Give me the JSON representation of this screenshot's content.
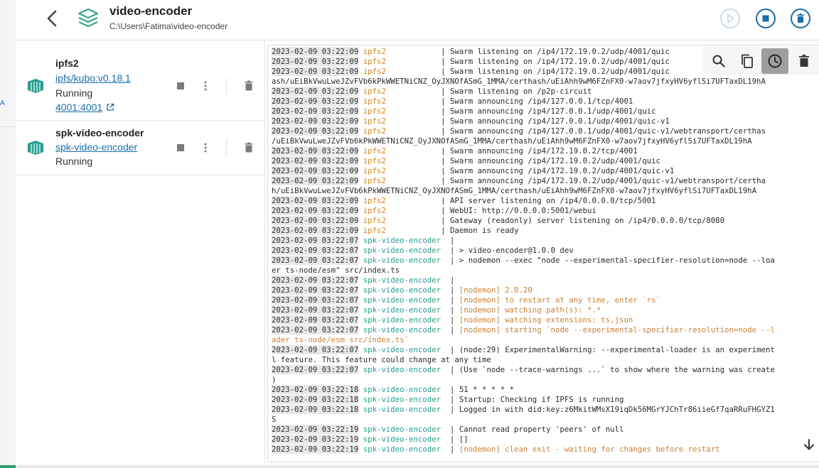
{
  "header": {
    "title": "video-encoder",
    "path": "C:\\Users\\Fatima\\video-encoder"
  },
  "leftrail": {
    "letter": "A"
  },
  "containers": [
    {
      "name": "ipfs2",
      "image": "ipfs/kubo:v0.18.1",
      "status": "Running",
      "port": "4001:4001"
    },
    {
      "name": "spk-video-encoder",
      "image": "spk-video-encoder",
      "status": "Running"
    }
  ],
  "colors": {
    "accent": "#1a6fa8",
    "container_icon": "#2a9d8f",
    "ipfs_service": "#d9841a",
    "spk_service": "#2a9d8f",
    "nodemon": "#c8833a"
  },
  "icons": {
    "header": [
      "back-arrow-icon",
      "stack-icon",
      "play-icon",
      "stop-icon",
      "delete-icon"
    ],
    "toolbar": [
      "search-icon",
      "copy-icon",
      "clock-icon",
      "delete-icon"
    ],
    "row": [
      "container-icon",
      "stop-icon",
      "more-vertical-icon",
      "delete-icon"
    ]
  },
  "logs": [
    {
      "ts": "2023-02-09 03:22:09",
      "svc": "ipfs2",
      "sep": "            | ",
      "msg": "Swarm listening on /ip4/172.19.0.2/udp/4001/quic"
    },
    {
      "ts": "2023-02-09 03:22:09",
      "svc": "ipfs2",
      "sep": "            | ",
      "msg": "Swarm listening on /ip4/172.19.0.2/udp/4001/quic"
    },
    {
      "ts": "2023-02-09 03:22:09",
      "svc": "ipfs2",
      "sep": "            | ",
      "msg": "Swarm listening on /ip4/172.19.0.2/udp/4001/quic"
    },
    {
      "cont": "ash/uEiBkVwuLweJZvFVb6kPkWWETNiCNZ_OyJXNOfASmG_1MMA/certhash/uEiAhh9wM6FZnFX0-w7aov7jfxyHV6yflSi7UFTaxDL19hA"
    },
    {
      "ts": "2023-02-09 03:22:09",
      "svc": "ipfs2",
      "sep": "            | ",
      "msg": "Swarm listening on /p2p-circuit"
    },
    {
      "ts": "2023-02-09 03:22:09",
      "svc": "ipfs2",
      "sep": "            | ",
      "msg": "Swarm announcing /ip4/127.0.0.1/tcp/4001"
    },
    {
      "ts": "2023-02-09 03:22:09",
      "svc": "ipfs2",
      "sep": "            | ",
      "msg": "Swarm announcing /ip4/127.0.0.1/udp/4001/quic"
    },
    {
      "ts": "2023-02-09 03:22:09",
      "svc": "ipfs2",
      "sep": "            | ",
      "msg": "Swarm announcing /ip4/127.0.0.1/udp/4001/quic-v1"
    },
    {
      "ts": "2023-02-09 03:22:09",
      "svc": "ipfs2",
      "sep": "            | ",
      "msg": "Swarm announcing /ip4/127.0.0.1/udp/4001/quic-v1/webtransport/certhas"
    },
    {
      "cont": "/uEiBkVwuLweJZvFVb6kPkWWETNiCNZ_OyJXNOfASmG_1MMA/certhash/uEiAhh9wM6FZnFX0-w7aov7jfxyHV6yflSi7UFTaxDL19hA"
    },
    {
      "ts": "2023-02-09 03:22:09",
      "svc": "ipfs2",
      "sep": "            | ",
      "msg": "Swarm announcing /ip4/172.19.0.2/tcp/4001"
    },
    {
      "ts": "2023-02-09 03:22:09",
      "svc": "ipfs2",
      "sep": "            | ",
      "msg": "Swarm announcing /ip4/172.19.0.2/udp/4001/quic"
    },
    {
      "ts": "2023-02-09 03:22:09",
      "svc": "ipfs2",
      "sep": "            | ",
      "msg": "Swarm announcing /ip4/172.19.0.2/udp/4001/quic-v1"
    },
    {
      "ts": "2023-02-09 03:22:09",
      "svc": "ipfs2",
      "sep": "            | ",
      "msg": "Swarm announcing /ip4/172.19.0.2/udp/4001/quic-v1/webtransport/certha"
    },
    {
      "cont": "h/uEiBkVwuLweJZvFVb6kPkWWETNiCNZ_OyJXNOfASmG_1MMA/certhash/uEiAhh9wM6FZnFX0-w7aov7jfxyHV6yflSi7UFTaxDL19hA"
    },
    {
      "ts": "2023-02-09 03:22:09",
      "svc": "ipfs2",
      "sep": "            | ",
      "msg": "API server listening on /ip4/0.0.0.0/tcp/5001"
    },
    {
      "ts": "2023-02-09 03:22:09",
      "svc": "ipfs2",
      "sep": "            | ",
      "msg": "WebUI: http://0.0.0.0:5001/webui"
    },
    {
      "ts": "2023-02-09 03:22:09",
      "svc": "ipfs2",
      "sep": "            | ",
      "msg": "Gateway (readonly) server listening on /ip4/0.0.0.0/tcp/8080"
    },
    {
      "ts": "2023-02-09 03:22:09",
      "svc": "ipfs2",
      "sep": "            | ",
      "msg": "Daemon is ready"
    },
    {
      "ts": "2023-02-09 03:22:07",
      "svc": "spk-video-encoder",
      "sep": "  | ",
      "msg": ""
    },
    {
      "ts": "2023-02-09 03:22:07",
      "svc": "spk-video-encoder",
      "sep": "  | ",
      "msg": "> video-encoder@1.0.0 dev"
    },
    {
      "ts": "2023-02-09 03:22:07",
      "svc": "spk-video-encoder",
      "sep": "  | ",
      "msg": "> nodemon --exec \"node --experimental-specifier-resolution=node --loa"
    },
    {
      "cont": "er ts-node/esm\" src/index.ts"
    },
    {
      "ts": "2023-02-09 03:22:07",
      "svc": "spk-video-encoder",
      "sep": "  | ",
      "msg": ""
    },
    {
      "ts": "2023-02-09 03:22:07",
      "svc": "spk-video-encoder",
      "sep": "  | ",
      "msg": "[nodemon] 2.0.20",
      "nm": true
    },
    {
      "ts": "2023-02-09 03:22:07",
      "svc": "spk-video-encoder",
      "sep": "  | ",
      "msg": "[nodemon] to restart at any time, enter `rs`",
      "nm": true
    },
    {
      "ts": "2023-02-09 03:22:07",
      "svc": "spk-video-encoder",
      "sep": "  | ",
      "msg": "[nodemon] watching path(s): *.*",
      "nm": true
    },
    {
      "ts": "2023-02-09 03:22:07",
      "svc": "spk-video-encoder",
      "sep": "  | ",
      "msg": "[nodemon] watching extensions: ts,json",
      "nm": true
    },
    {
      "ts": "2023-02-09 03:22:07",
      "svc": "spk-video-encoder",
      "sep": "  | ",
      "msg": "[nodemon] starting `node --experimental-specifier-resolution=node --l",
      "nm": true
    },
    {
      "cont": "ader ts-node/esm src/index.ts`",
      "nm": true
    },
    {
      "ts": "2023-02-09 03:22:07",
      "svc": "spk-video-encoder",
      "sep": "  | ",
      "msg": "(node:29) ExperimentalWarning: --experimental-loader is an experiment"
    },
    {
      "cont": "l feature. This feature could change at any time"
    },
    {
      "ts": "2023-02-09 03:22:07",
      "svc": "spk-video-encoder",
      "sep": "  | ",
      "msg": "(Use `node --trace-warnings ...` to show where the warning was create"
    },
    {
      "cont": ")"
    },
    {
      "ts": "2023-02-09 03:22:18",
      "svc": "spk-video-encoder",
      "sep": "  | ",
      "msg": "51 * * * * *"
    },
    {
      "ts": "2023-02-09 03:22:18",
      "svc": "spk-video-encoder",
      "sep": "  | ",
      "msg": "Startup: Checking if IPFS is running"
    },
    {
      "ts": "2023-02-09 03:22:18",
      "svc": "spk-video-encoder",
      "sep": "  | ",
      "msg": "Logged in with did:key:z6MkitWMsX19iqDk56MGrYJChTr86iieGf7qaRRuFHGYZ1"
    },
    {
      "cont": "S"
    },
    {
      "ts": "2023-02-09 03:22:19",
      "svc": "spk-video-encoder",
      "sep": "  | ",
      "msg": "Cannot read property 'peers' of null"
    },
    {
      "ts": "2023-02-09 03:22:19",
      "svc": "spk-video-encoder",
      "sep": "  | ",
      "msg": "[]"
    },
    {
      "ts": "2023-02-09 03:22:19",
      "svc": "spk-video-encoder",
      "sep": "  | ",
      "msg": "[nodemon] clean exit - waiting for changes before restart",
      "nm": true
    }
  ]
}
